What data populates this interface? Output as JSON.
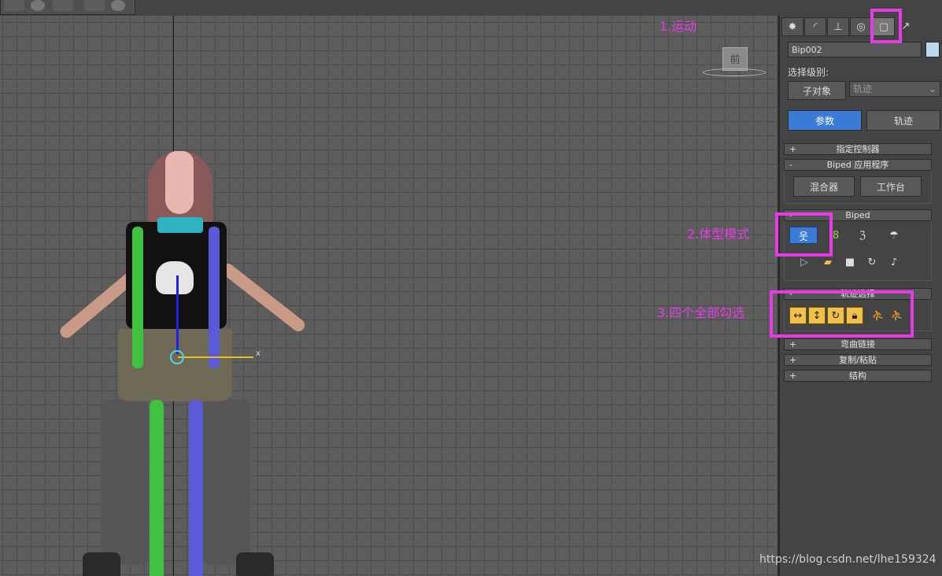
{
  "annotations": {
    "step1": "1.运动",
    "step2": "2.体型模式",
    "step3": "3.四个全部勾选"
  },
  "viewport": {
    "viewcube_label": "前",
    "gizmo_x_label": "x"
  },
  "panel": {
    "object_name": "Bip002",
    "color": "#bdd9f0",
    "selection_level_label": "选择级别:",
    "sub_object_button": "子对象",
    "track_dropdown": "轨迹",
    "params_tab": "参数",
    "track_tab": "轨迹",
    "rollouts": {
      "assign_controller": "指定控制器",
      "biped_apps": "Biped 应用程序",
      "mixer_button": "混合器",
      "workbench_button": "工作台",
      "biped": "Biped",
      "track_selection": "轨迹选择",
      "bend_links": "弯曲链接",
      "copy_paste": "复制/粘贴",
      "structure": "结构"
    }
  },
  "colors": {
    "highlight": "#e63ce6",
    "selected_button": "#3a7bd5",
    "yellow_toggle": "#f2c14a"
  },
  "watermark": "https://blog.csdn.net/lhe159324"
}
